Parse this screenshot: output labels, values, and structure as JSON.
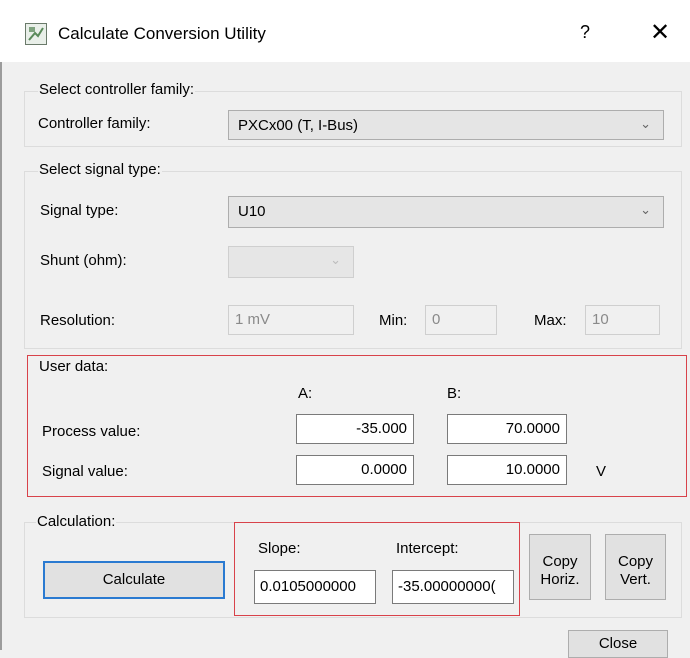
{
  "window": {
    "title": "Calculate Conversion Utility",
    "help_label": "?",
    "close_label": "✕"
  },
  "controller_group": {
    "label": "Select controller family:",
    "field_label": "Controller family:",
    "value": "PXCx00 (T, I-Bus)"
  },
  "signal_group": {
    "label": "Select signal type:",
    "signal_type_label": "Signal type:",
    "signal_type_value": "U10",
    "shunt_label": "Shunt (ohm):",
    "resolution_label": "Resolution:",
    "resolution_value": "1 mV",
    "min_label": "Min:",
    "min_value": "0",
    "max_label": "Max:",
    "max_value": "10"
  },
  "user_data": {
    "label": "User data:",
    "col_a": "A:",
    "col_b": "B:",
    "process_label": "Process value:",
    "process_a": "-35.000",
    "process_b": "70.0000",
    "signal_label": "Signal value:",
    "signal_a": "0.0000",
    "signal_b": "10.0000",
    "unit": "V"
  },
  "calculation": {
    "label": "Calculation:",
    "calculate_button": "Calculate",
    "slope_label": "Slope:",
    "slope_value": "0.0105000000",
    "intercept_label": "Intercept:",
    "intercept_value": "-35.00000000(",
    "copy_horiz_line1": "Copy",
    "copy_horiz_line2": "Horiz.",
    "copy_vert_line1": "Copy",
    "copy_vert_line2": "Vert."
  },
  "footer": {
    "close_button": "Close"
  }
}
